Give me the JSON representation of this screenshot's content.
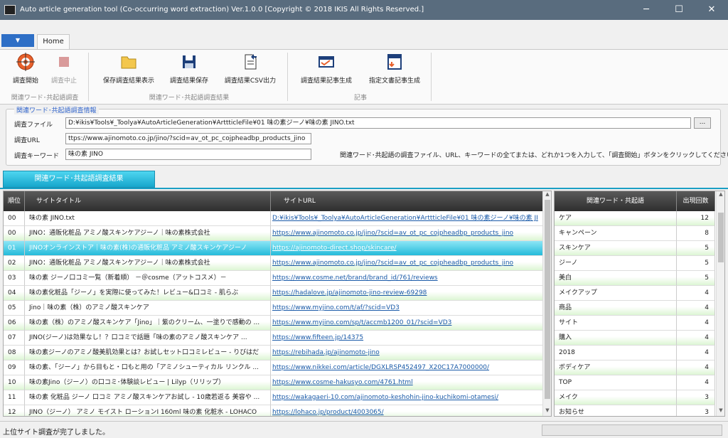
{
  "window": {
    "title": "Auto article generation tool (Co-occurring word extraction) Ver.1.0.0  [Copyright © 2018 IKIS All Rights Reserved.]",
    "minimize": "─",
    "maximize": "☐",
    "close": "✕"
  },
  "ribbon": {
    "file_menu": "▼",
    "tab_home": "Home",
    "buttons": {
      "start": "調査開始",
      "stop": "調査中止",
      "show_saved": "保存調査結果表示",
      "save": "調査結果保存",
      "csv": "調査結果CSV出力",
      "gen_article": "調査結果記事生成",
      "gen_specified": "指定文書記事生成"
    },
    "groups": {
      "survey": "関連ワード･共起語調査",
      "results": "関連ワード･共起語調査結果",
      "article": "記事"
    }
  },
  "info": {
    "title": "関連ワード･共起語調査情報",
    "file_label": "調査ファイル",
    "file_value": "D:¥ikis¥Tools¥_Toolya¥AutoArticleGeneration¥ArttticleFile¥01 味の素ジーノ¥味の素 JINO.txt",
    "browse": "...",
    "url_label": "調査URL",
    "url_value": "ttps://www.ajinomoto.co.jp/jino/?scid=av_ot_pc_cojpheadbp_products_jino",
    "keyword_label": "調査キーワード",
    "keyword_value": "味の素 JINO",
    "hint": "関連ワード･共起語の調査ファイル、URL、キーワードの全てまたは、どれか1つを入力して、「調査開始」ボタンをクリックしてください。"
  },
  "results_tab": "関連ワード･共起語調査結果",
  "site_table": {
    "headers": [
      "順位",
      "サイトタイトル",
      "サイトURL"
    ],
    "rows": [
      {
        "rank": "00",
        "title": "味の素 JINO.txt",
        "url": "D:¥ikis¥Tools¥_Toolya¥AutoArticleGeneration¥ArttticleFile¥01 味の素ジーノ¥味の素 JI"
      },
      {
        "rank": "00",
        "title": "JINO：通販化粧品 アミノ酸スキンケアジーノ｜味の素株式会社",
        "url": "https://www.ajinomoto.co.jp/jino/?scid=av_ot_pc_cojpheadbp_products_jino"
      },
      {
        "rank": "01",
        "title": "JINOオンラインストア｜味の素(株)の通販化粧品 アミノ酸スキンケアジーノ",
        "url": "https://ajinomoto-direct.shop/skincare/"
      },
      {
        "rank": "02",
        "title": "JINO：通販化粧品 アミノ酸スキンケアジーノ｜味の素株式会社",
        "url": "https://www.ajinomoto.co.jp/jino/?scid=av_ot_pc_cojpheadbp_products_jino"
      },
      {
        "rank": "03",
        "title": "味の素 ジーノ口コミ一覧（新着順） －＠cosme（アットコスメ）－",
        "url": "https://www.cosme.net/brand/brand_id/761/reviews"
      },
      {
        "rank": "04",
        "title": "味の素化粧品「ジーノ」を実際に使ってみた！レビュー&口コミ - 肌らぶ",
        "url": "https://hadalove.jp/ajinomoto-jino-review-69298"
      },
      {
        "rank": "05",
        "title": "Jino｜味の素（株）のアミノ酸スキンケア",
        "url": "https://www.myjino.com/t/af/?scid=VD3"
      },
      {
        "rank": "06",
        "title": "味の素（株）のアミノ酸スキンケア「Jino」｜紫のクリーム、一塗りで感動の ...",
        "url": "https://www.myjino.com/sp/t/accmb1200_01/?scid=VD3"
      },
      {
        "rank": "07",
        "title": "JINO(ジーノ)は効果なし！？口コミで話題「味の素のアミノ酸スキンケア ...",
        "url": "https://www.fifteen.jp/14375"
      },
      {
        "rank": "08",
        "title": "味の素ジーノのアミノ酸美肌効果とは？お試しセット口コミレビュー - りびはだ",
        "url": "https://rebihada.jp/ajinomoto-jino"
      },
      {
        "rank": "09",
        "title": "味の素、「ジーノ」から目もと・口もと用の「アミノシューティカル リンクル ...",
        "url": "https://www.nikkei.com/article/DGXLRSP452497_X20C17A7000000/"
      },
      {
        "rank": "10",
        "title": "味の素Jino（ジーノ）の口コミ･体験談レビュー | Lilyp（リリップ）",
        "url": "https://www.cosme-hakusyo.com/4761.html"
      },
      {
        "rank": "11",
        "title": "味の素 化粧品 ジーノ 口コミ アミノ酸スキンケアお試し - 10歳若返る 美容や ...",
        "url": "https://wakagaeri-10.com/ajinomoto-keshohin-jino-kuchikomi-otamesi/"
      },
      {
        "rank": "12",
        "title": "JINO（ジーノ） アミノ モイスト ローションI 160ml 味の素 化粧水 - LOHACO",
        "url": "https://lohaco.jp/product/4003065/"
      }
    ]
  },
  "keyword_table": {
    "headers": [
      "関連ワード・共起語",
      "出現回数"
    ],
    "rows": [
      {
        "word": "ケア",
        "count": "12"
      },
      {
        "word": "キャンペーン",
        "count": "8"
      },
      {
        "word": "スキンケア",
        "count": "5"
      },
      {
        "word": "ジーノ",
        "count": "5"
      },
      {
        "word": "美白",
        "count": "5"
      },
      {
        "word": "メイクアップ",
        "count": "4"
      },
      {
        "word": "商品",
        "count": "4"
      },
      {
        "word": "サイト",
        "count": "4"
      },
      {
        "word": "購入",
        "count": "4"
      },
      {
        "word": "2018",
        "count": "4"
      },
      {
        "word": "ボディケア",
        "count": "4"
      },
      {
        "word": "TOP",
        "count": "4"
      },
      {
        "word": "メイク",
        "count": "3"
      },
      {
        "word": "お知らせ",
        "count": "3"
      }
    ]
  },
  "status": {
    "text": "上位サイト調査が完了しました。"
  }
}
